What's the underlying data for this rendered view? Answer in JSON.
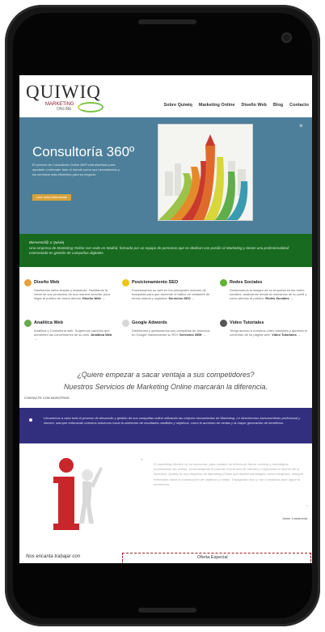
{
  "site": {
    "logo": "QUIWIQ",
    "logo_sub": "MARKETING",
    "logo_sub2": "ONLINE"
  },
  "nav": [
    "Sobre Quiwiq",
    "Marketing Online",
    "Diseño Web",
    "Blog",
    "Contacto"
  ],
  "hero": {
    "title": "Consultoría 360º",
    "text": "El servicio de Consultoría Online 360º está diseñado para ayudarle a entender todo el mundo como sus herramientas y los servicios más eficientes para su negocio.",
    "button": "Leer más información",
    "close": "×"
  },
  "welcome": {
    "title": "Bienvenid@ a Quiwiq",
    "text": "Una empresa de Marketing Online con sede en Madrid, formada por un equipo de personas que se dedican con pasión al Marketing y tienen una profesionalidad contrastada en gestión de campañas digitales."
  },
  "services": [
    {
      "title": "Diseño Web",
      "text": "Diseñamos webs limpias y atractivas. Facilitando la venta de sus productos de una manera sencilla, para llegar al público de forma directa.",
      "link": "Diseño Web →",
      "color": "#e5a43a"
    },
    {
      "title": "Posicionamiento SEO",
      "text": "Posicionamos su web en los principales motores de búsqueda para que aumente el tráfico de visitantes de forma natural y orgánica.",
      "link": "Servicios SEO →",
      "color": "#f0c419"
    },
    {
      "title": "Redes Sociales",
      "text": "Gestionamos la imagen de su empresa en las redes sociales, analizando desde la relevancia de su perfil y cómo afectan al público.",
      "link": "Redes Sociales →",
      "color": "#66b03a"
    },
    {
      "title": "Analítica Web",
      "text": "Analítica y Consultoría web. Sugerimos cambios que aumenten las conversiones de su web.",
      "link": "Analítica Web →",
      "color": "#6aa84f"
    },
    {
      "title": "Google Adwords",
      "text": "Diseñamos y gestionamos sus campañas de anuncios en Google maximizando su ROI.",
      "link": "Servicios SEM →",
      "color": "#d7d7d7"
    },
    {
      "title": "Vídeo Tutoriales",
      "text": "Tenga acceso a nuestros vídeo tutoriales y aprenda el contenido de su página web.",
      "link": "Vídeo Tutoriales →",
      "color": "#555555"
    }
  ],
  "cta": {
    "line1": "¿Quiere empezar a sacar ventaja a sus competidores?",
    "line2": "Nuestros Servicios de Marketing Online marcarán la diferencia.",
    "contact": "CONTACTE CON NOSOTROS"
  },
  "band": {
    "text": "Llevaremos a cabo todo el proceso de desarrollo y gestión de sus campañas online utilizando las mejores herramientas de Marketing. Le ofreceremos asesoramiento profesional y sincero, siempre enfocando nuestros esfuerzos hacia la obtención de resultados medibles y objetivos, como el aumento de ventas y la mayor generación de beneficios."
  },
  "testimonial": {
    "quote_open": "“",
    "quote_close": "”",
    "text": "El marketing efectivo no se improvisa, para cuidarlo se enfoca de forma correcta y estratégica, aumentando las ventas, incrementando la tasa de conversión de clientes y mejorando el retorno de la inversión. Quiwiq es una empresa de Marketing Online que diseña estrategias online integrales, siempre enfocadas hacia la consecución de objetivos y metas. Trabajando duro y con constancia para lograr la excelencia.",
    "author": "Javier Castaneda"
  },
  "bottom": {
    "left": "Nos encanta trabajar con",
    "offer": "Oferta Especial"
  },
  "colors": {
    "hero": "#4d7f9a",
    "welcome": "#176a1f",
    "band": "#322f7f",
    "accent": "#d8a23a"
  }
}
